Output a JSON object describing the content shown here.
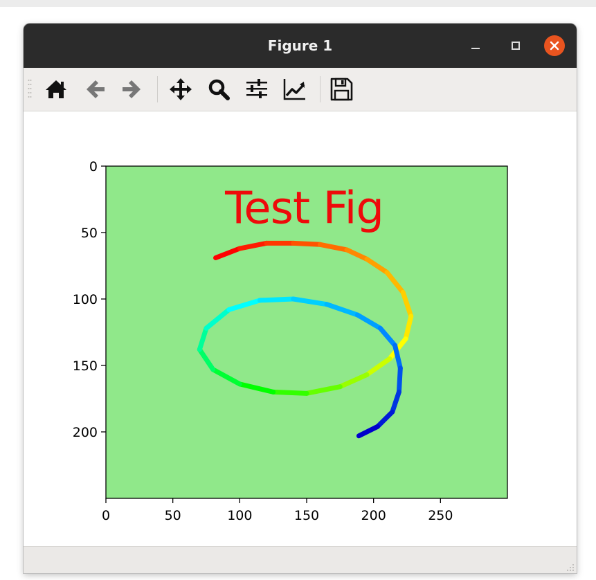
{
  "window": {
    "title": "Figure 1",
    "titlebar_color": "#2b2b2b",
    "close_button_color": "#e9541f"
  },
  "toolbar": {
    "buttons": [
      {
        "icon": "home-icon",
        "tooltip": "Home"
      },
      {
        "icon": "back-arrow-icon",
        "tooltip": "Back"
      },
      {
        "icon": "forward-arrow-icon",
        "tooltip": "Forward"
      },
      {
        "icon": "pan-move-icon",
        "tooltip": "Pan"
      },
      {
        "icon": "zoom-magnifier-icon",
        "tooltip": "Zoom"
      },
      {
        "icon": "subplots-sliders-icon",
        "tooltip": "Configure subplots"
      },
      {
        "icon": "edit-axis-chart-icon",
        "tooltip": "Edit axis"
      },
      {
        "icon": "save-floppy-icon",
        "tooltip": "Save"
      }
    ]
  },
  "chart_data": {
    "type": "image",
    "background_color": "#90e88a",
    "xlim": [
      0,
      300
    ],
    "ylim": [
      250,
      0
    ],
    "y_inverted": true,
    "x_ticks": [
      0,
      50,
      100,
      150,
      200,
      250
    ],
    "y_ticks": [
      0,
      50,
      100,
      150,
      200
    ],
    "x_tick_labels": [
      "0",
      "50",
      "100",
      "150",
      "200",
      "250"
    ],
    "y_tick_labels": [
      "0",
      "50",
      "100",
      "150",
      "200"
    ],
    "image_text": {
      "text": "Test Fig",
      "x": 89,
      "y": 43,
      "color": "#ee0a0a"
    },
    "spiral_colormap": [
      "#ff0000",
      "#ff8800",
      "#ffff00",
      "#00ff00",
      "#00ffff",
      "#0088ff",
      "#0000cc"
    ],
    "spiral_points": [
      [
        82,
        69
      ],
      [
        100,
        62
      ],
      [
        120,
        58
      ],
      [
        140,
        58
      ],
      [
        160,
        59
      ],
      [
        180,
        63
      ],
      [
        195,
        70
      ],
      [
        210,
        80
      ],
      [
        222,
        95
      ],
      [
        228,
        113
      ],
      [
        224,
        130
      ],
      [
        212,
        145
      ],
      [
        195,
        157
      ],
      [
        175,
        166
      ],
      [
        150,
        171
      ],
      [
        125,
        170
      ],
      [
        100,
        164
      ],
      [
        80,
        153
      ],
      [
        70,
        138
      ],
      [
        75,
        122
      ],
      [
        92,
        108
      ],
      [
        115,
        101
      ],
      [
        140,
        100
      ],
      [
        165,
        104
      ],
      [
        188,
        112
      ],
      [
        205,
        122
      ],
      [
        216,
        135
      ],
      [
        220,
        152
      ],
      [
        219,
        170
      ],
      [
        214,
        185
      ],
      [
        203,
        196
      ],
      [
        189,
        203
      ]
    ]
  }
}
